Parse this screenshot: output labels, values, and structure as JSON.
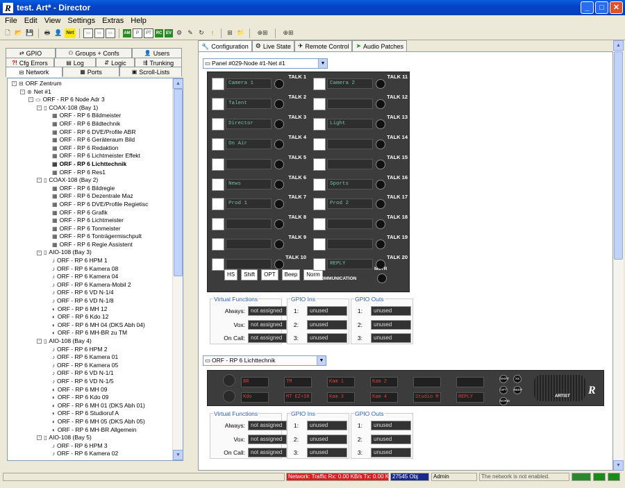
{
  "window": {
    "title": "test. Art* - Director",
    "logo": "R"
  },
  "menu": [
    "File",
    "Edit",
    "View",
    "Settings",
    "Extras",
    "Help"
  ],
  "toolbar": {
    "net_label": "Net",
    "icons": [
      "new-icon",
      "open-icon",
      "save-icon",
      "print-icon",
      "user-icon"
    ],
    "mini_labels": [
      "AM",
      "P",
      "PT",
      "RC",
      "EV"
    ]
  },
  "left_tabs": {
    "row1": [
      {
        "label": "GPIO",
        "icon": "gpio-icon"
      },
      {
        "label": "Groups + Confs",
        "icon": "groups-icon"
      },
      {
        "label": "Users",
        "icon": "users-icon"
      }
    ],
    "row2": [
      {
        "label": "Cfg Errors",
        "icon": "errors-icon"
      },
      {
        "label": "Log",
        "icon": "log-icon"
      },
      {
        "label": "Logic",
        "icon": "logic-icon"
      },
      {
        "label": "Trunking",
        "icon": "trunking-icon"
      }
    ],
    "row3": [
      {
        "label": "Network",
        "icon": "network-icon"
      },
      {
        "label": "Ports",
        "icon": "ports-icon"
      },
      {
        "label": "Scroll-Lists",
        "icon": "scroll-icon"
      }
    ]
  },
  "tree": [
    {
      "level": 0,
      "ex": "-",
      "icon": "network",
      "label": "ORF Zentrum"
    },
    {
      "level": 1,
      "ex": "-",
      "icon": "net",
      "label": "Net #1"
    },
    {
      "level": 2,
      "ex": "-",
      "icon": "node",
      "label": "ORF - RP 6 Node Adr 3"
    },
    {
      "level": 3,
      "ex": "-",
      "icon": "card",
      "label": "COAX-108 (Bay  1)"
    },
    {
      "level": 4,
      "icon": "panel",
      "label": "ORF - RP 6 Bildmeister"
    },
    {
      "level": 4,
      "icon": "panel",
      "label": "ORF - RP 6 Bildtechnik"
    },
    {
      "level": 4,
      "icon": "panel",
      "label": "ORF - RP 6 DVE/Profile ABR"
    },
    {
      "level": 4,
      "icon": "panel",
      "label": "ORF - RP 6 Geräteraum Bild"
    },
    {
      "level": 4,
      "icon": "panel",
      "label": "ORF - RP 6 Redaktion"
    },
    {
      "level": 4,
      "icon": "panel",
      "label": "ORF - RP 6 Lichtmeister Effekt"
    },
    {
      "level": 4,
      "icon": "panel",
      "label": "ORF - RP 6 Lichttechnik",
      "bold": true
    },
    {
      "level": 4,
      "icon": "panel",
      "label": "ORF - RP 6 Res1"
    },
    {
      "level": 3,
      "ex": "-",
      "icon": "card",
      "label": "COAX-108 (Bay  2)"
    },
    {
      "level": 4,
      "icon": "panel",
      "label": "ORF - RP 6 Bildregie"
    },
    {
      "level": 4,
      "icon": "panel",
      "label": "ORF - RP 6 Dezentrale Maz"
    },
    {
      "level": 4,
      "icon": "panel",
      "label": "ORF - RP 6 DVE/Profile Regietisc"
    },
    {
      "level": 4,
      "icon": "panel",
      "label": "ORF - RP 6 Grafik"
    },
    {
      "level": 4,
      "icon": "panel",
      "label": "ORF - RP 6 Lichtmeister"
    },
    {
      "level": 4,
      "icon": "panel",
      "label": "ORF - RP 6 Tonmeister"
    },
    {
      "level": 4,
      "icon": "panel",
      "label": "ORF - RP 6 Tonträgermischpult"
    },
    {
      "level": 4,
      "icon": "panel",
      "label": "ORF - RP 6 Regie Assistent"
    },
    {
      "level": 3,
      "ex": "-",
      "icon": "card",
      "label": "AIO-108 (Bay  3)"
    },
    {
      "level": 4,
      "icon": "beltpack",
      "label": "ORF - RP 6 HPM 1"
    },
    {
      "level": 4,
      "icon": "beltpack",
      "label": "ORF - RP 6 Kamera 08"
    },
    {
      "level": 4,
      "icon": "beltpack",
      "label": "ORF - RP 6 Kamera 04"
    },
    {
      "level": 4,
      "icon": "beltpack",
      "label": "ORF - RP 6 Kamera-Mobil 2"
    },
    {
      "level": 4,
      "icon": "beltpack",
      "label": "ORF - RP 6 VD N-1/4"
    },
    {
      "level": 4,
      "icon": "beltpack",
      "label": "ORF - RP 6 VD N-1/8"
    },
    {
      "level": 4,
      "icon": "speaker",
      "label": "ORF - RP 6 MH 12"
    },
    {
      "level": 4,
      "icon": "speaker",
      "label": "ORF - RP 6 Kdo 12"
    },
    {
      "level": 4,
      "icon": "speaker",
      "label": "ORF - RP 6 MH 04 (DKS Abh 04)"
    },
    {
      "level": 4,
      "icon": "speaker",
      "label": "ORF - RP 6 MH-BR zu TM"
    },
    {
      "level": 3,
      "ex": "-",
      "icon": "card",
      "label": "AIO-108 (Bay  4)"
    },
    {
      "level": 4,
      "icon": "beltpack",
      "label": "ORF - RP 6 HPM 2"
    },
    {
      "level": 4,
      "icon": "beltpack",
      "label": "ORF - RP 6 Kamera 01"
    },
    {
      "level": 4,
      "icon": "beltpack",
      "label": "ORF - RP 6 Kamera 05"
    },
    {
      "level": 4,
      "icon": "beltpack",
      "label": "ORF - RP 6 VD N-1/1"
    },
    {
      "level": 4,
      "icon": "beltpack",
      "label": "ORF - RP 6 VD N-1/5"
    },
    {
      "level": 4,
      "icon": "speaker",
      "label": "ORF - RP 6 MH 09"
    },
    {
      "level": 4,
      "icon": "speaker",
      "label": "ORF - RP 6 Kdo 09"
    },
    {
      "level": 4,
      "icon": "speaker",
      "label": "ORF - RP 6 MH 01 (DKS Abh 01)"
    },
    {
      "level": 4,
      "icon": "speaker",
      "label": "ORF - RP 6 Studioruf A"
    },
    {
      "level": 4,
      "icon": "speaker",
      "label": "ORF - RP 6 MH 05 (DKS Abh 05)"
    },
    {
      "level": 4,
      "icon": "speaker",
      "label": "ORF - RP 6 MH-BR Allgemein"
    },
    {
      "level": 3,
      "ex": "-",
      "icon": "card",
      "label": "AIO-108 (Bay  5)"
    },
    {
      "level": 4,
      "icon": "beltpack",
      "label": "ORF - RP 6 HPM 3"
    },
    {
      "level": 4,
      "icon": "beltpack",
      "label": "ORF - RP 6 Kamera 02"
    }
  ],
  "right_tabs": [
    {
      "label": "Configuration",
      "icon": "wrench-icon"
    },
    {
      "label": "Live State",
      "icon": "live-icon"
    },
    {
      "label": "Remote Control",
      "icon": "remote-icon"
    },
    {
      "label": "Audio Patches",
      "icon": "patch-icon"
    }
  ],
  "panel1": {
    "combo": "Panel #029-Node #1-Net #1",
    "keys_left": [
      {
        "talk": "TALK 1",
        "label": "Camera 1"
      },
      {
        "talk": "TALK 2",
        "label": "Talent"
      },
      {
        "talk": "TALK 3",
        "label": "Director"
      },
      {
        "talk": "TALK 4",
        "label": "On Air"
      },
      {
        "talk": "TALK 5",
        "label": ""
      },
      {
        "talk": "TALK 6",
        "label": "News"
      },
      {
        "talk": "TALK 7",
        "label": "Prod 1"
      },
      {
        "talk": "TALK 8",
        "label": ""
      },
      {
        "talk": "TALK 9",
        "label": ""
      },
      {
        "talk": "TALK 10",
        "label": ""
      }
    ],
    "keys_right": [
      {
        "talk": "TALK 11",
        "label": "Camera 2"
      },
      {
        "talk": "TALK 12",
        "label": ""
      },
      {
        "talk": "TALK 13",
        "label": "Light"
      },
      {
        "talk": "TALK 14",
        "label": ""
      },
      {
        "talk": "TALK 15",
        "label": ""
      },
      {
        "talk": "TALK 16",
        "label": "Sports"
      },
      {
        "talk": "TALK 17",
        "label": "Prod 2"
      },
      {
        "talk": "TALK 18",
        "label": ""
      },
      {
        "talk": "TALK 19",
        "label": ""
      },
      {
        "talk": "TALK 20",
        "label": "REPLY"
      }
    ],
    "buttons": [
      "HS",
      "Shift",
      "OPT",
      "Beep",
      "Norm"
    ],
    "communication": "COMMUNICATION",
    "mstr": "MSTR",
    "virtual": {
      "title": "Virtual Functions",
      "rows": [
        {
          "label": "Always:",
          "value": "not assigned"
        },
        {
          "label": "Vox:",
          "value": "not assigned"
        },
        {
          "label": "On Call:",
          "value": "not assigned"
        }
      ]
    },
    "gpio_ins": {
      "title": "GPIO Ins",
      "rows": [
        {
          "label": "1:",
          "value": "unused"
        },
        {
          "label": "2:",
          "value": "unused"
        },
        {
          "label": "3:",
          "value": "unused"
        }
      ]
    },
    "gpio_outs": {
      "title": "GPIO Outs",
      "rows": [
        {
          "label": "1:",
          "value": "unused"
        },
        {
          "label": "2:",
          "value": "unused"
        },
        {
          "label": "3:",
          "value": "unused"
        }
      ]
    }
  },
  "panel2": {
    "combo": "ORF - RP 6 Lichttechnik",
    "keys_top": [
      "BR",
      "TM",
      "Kam 1",
      "Kam 2",
      "",
      ""
    ],
    "keys_bottom": [
      "Kdo",
      "MT EZ+S8",
      "Kam 3",
      "Kam 4",
      "Studio M",
      "REPLY"
    ],
    "side_buttons": [
      "SHIFT",
      "XS",
      "OPT",
      "BEEP",
      "NORM"
    ],
    "brand": "ARTIST",
    "virtual": {
      "title": "Virtual Functions",
      "rows": [
        {
          "label": "Always:",
          "value": "not assigned"
        },
        {
          "label": "Vox:",
          "value": "not assigned"
        },
        {
          "label": "On Call:",
          "value": "not assigned"
        }
      ]
    },
    "gpio_ins": {
      "title": "GPIO Ins",
      "rows": [
        {
          "label": "1:",
          "value": "unused"
        },
        {
          "label": "2:",
          "value": "unused"
        },
        {
          "label": "3:",
          "value": "unused"
        }
      ]
    },
    "gpio_outs": {
      "title": "GPIO Outs",
      "rows": [
        {
          "label": "1:",
          "value": "unused"
        },
        {
          "label": "2:",
          "value": "unused"
        },
        {
          "label": "3:",
          "value": "unused"
        }
      ]
    }
  },
  "status": {
    "traffic": "Network: Traffic Rx: 0.00 KB/s   Tx: 0.00 KB",
    "objects": "27545 Obj",
    "user": "Admin",
    "network": "The network is not enabled.",
    "traffic_color": "#d42020",
    "objects_color": "#1a2a8a"
  }
}
